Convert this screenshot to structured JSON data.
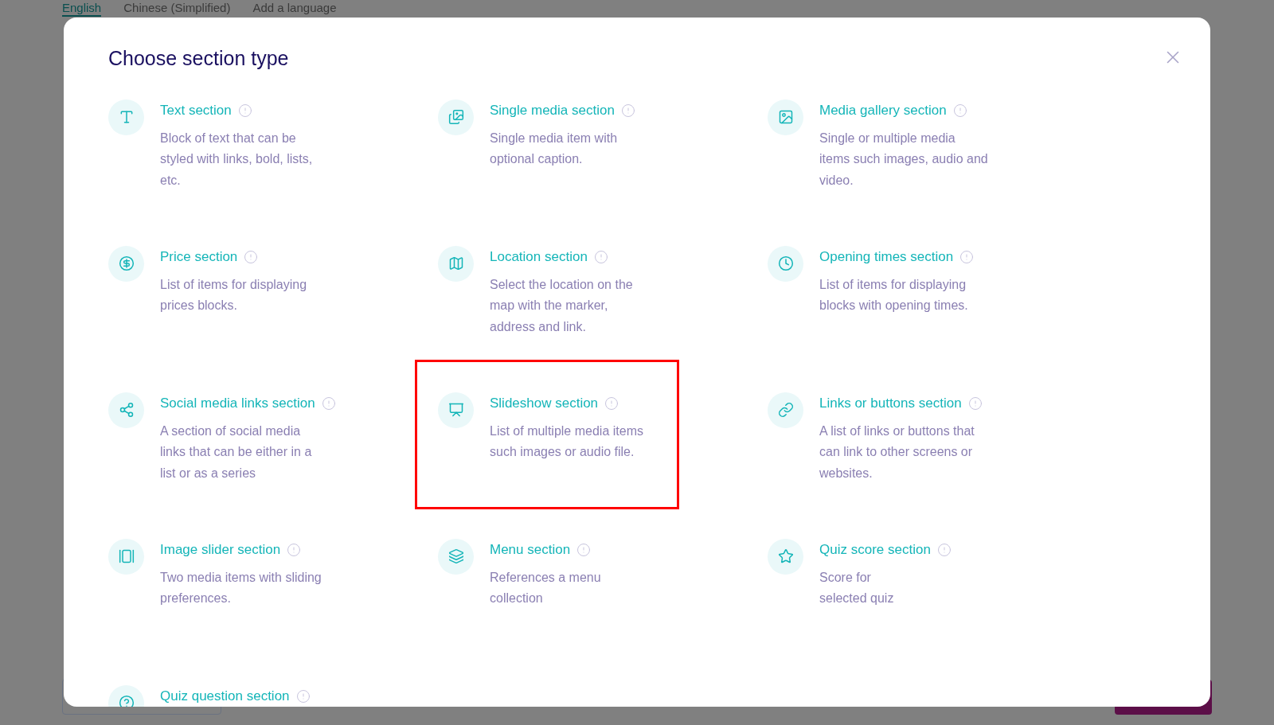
{
  "background": {
    "language_tabs": [
      {
        "label": "English",
        "selected": true
      },
      {
        "label": "Chinese (Simplified)",
        "selected": false
      },
      {
        "label": "Add a language",
        "selected": false
      }
    ]
  },
  "dialog": {
    "title": "Choose section type",
    "sections": [
      {
        "title": "Text section",
        "lines": [
          "Block of text that can be",
          "styled with links, bold, lists,",
          "etc."
        ],
        "highlighted": false
      },
      {
        "title": "Single media section",
        "lines": [
          "Single media item with",
          "optional caption."
        ],
        "highlighted": false
      },
      {
        "title": "Media gallery section",
        "lines": [
          "Single or multiple media",
          "items such images, audio and",
          "video."
        ],
        "highlighted": false
      },
      {
        "title": "Price section",
        "lines": [
          "List of items for displaying",
          "prices blocks."
        ],
        "highlighted": false
      },
      {
        "title": "Location section",
        "lines": [
          "Select the location on the",
          "map with the marker,",
          "address and link."
        ],
        "highlighted": false
      },
      {
        "title": "Opening times section",
        "lines": [
          "List of items for displaying",
          "blocks with opening times."
        ],
        "highlighted": false
      },
      {
        "title": "Social media links section",
        "lines": [
          "A section of social media",
          "links that can be either in a",
          "list or as a series"
        ],
        "highlighted": false
      },
      {
        "title": "Slideshow section",
        "lines": [
          "List of multiple media items",
          "such images or audio file."
        ],
        "highlighted": true
      },
      {
        "title": "Links or buttons section",
        "lines": [
          "A list of links or buttons that",
          "can link to other screens or",
          "websites."
        ],
        "highlighted": false
      },
      {
        "title": "Image slider section",
        "lines": [
          "Two media items with sliding",
          "preferences."
        ],
        "highlighted": false
      },
      {
        "title": "Menu section",
        "lines": [
          "References a menu",
          "collection"
        ],
        "highlighted": false
      },
      {
        "title": "Quiz score section",
        "lines": [
          "Score for",
          "selected quiz"
        ],
        "highlighted": false
      },
      {
        "title": "Quiz question section",
        "highlighted": false
      }
    ]
  }
}
